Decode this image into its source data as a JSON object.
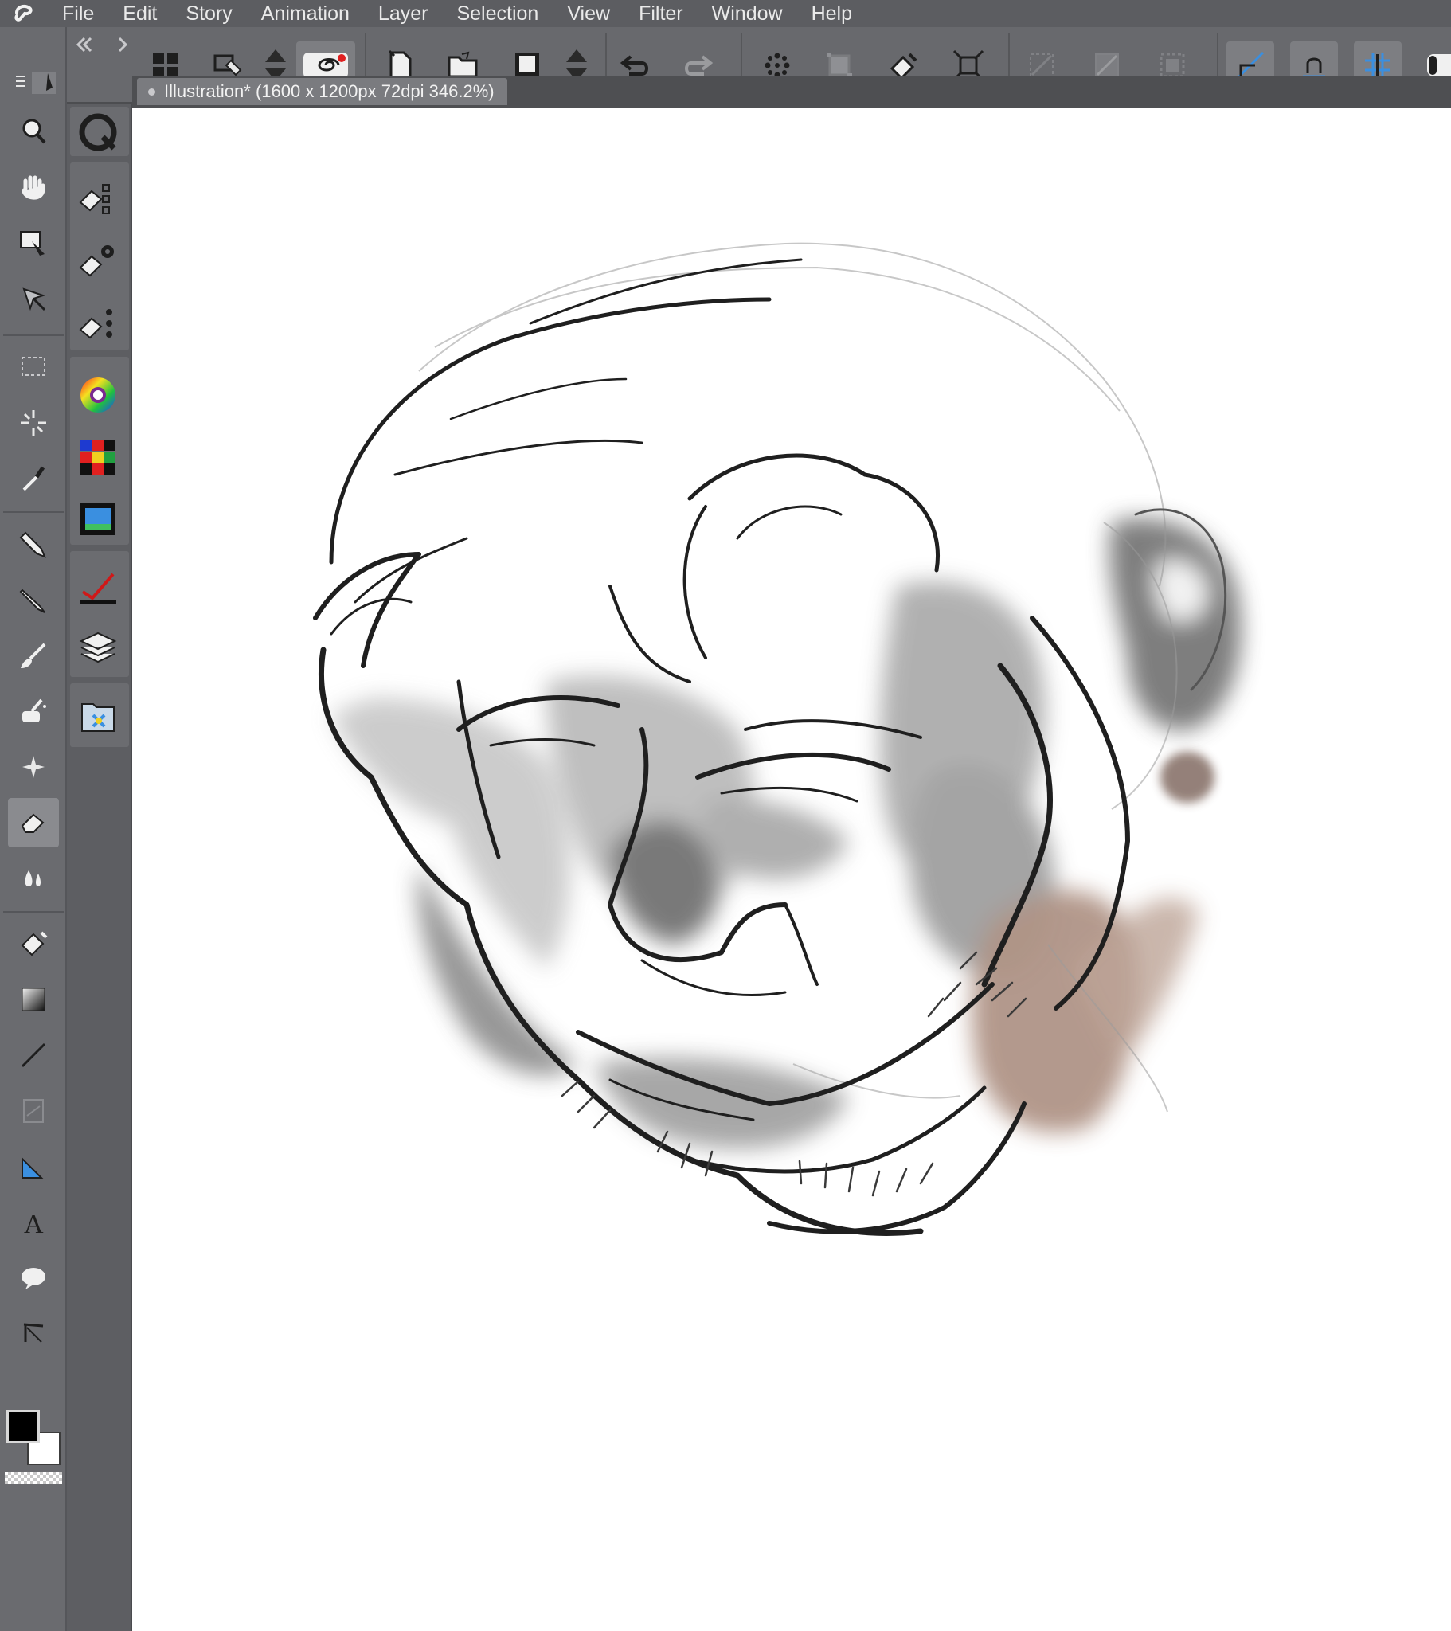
{
  "menu": {
    "items": [
      "File",
      "Edit",
      "Story",
      "Animation",
      "Layer",
      "Selection",
      "View",
      "Filter",
      "Window",
      "Help"
    ]
  },
  "command_bar": {
    "icons": [
      "sub-tool-grid-icon",
      "sub-view-icon",
      "up-down-arrows-icon",
      "spiral-icon",
      "new-file-icon",
      "open-folder-icon",
      "save-icon",
      "up-down-arrows-icon",
      "undo-icon",
      "redo-icon",
      "sparkle-icon",
      "transform-icon",
      "fill-icon",
      "expand-icon",
      "clear-outside-icon",
      "fill-selection-icon",
      "selection-border-icon",
      "snap-ruler-icon",
      "snap-special-ruler-icon",
      "snap-grid-icon"
    ]
  },
  "document": {
    "tab_title": "Illustration* (1600 x 1200px 72dpi 346.2%)"
  },
  "tools": {
    "items": [
      "zoom",
      "hand",
      "operation",
      "move-layer",
      "selection",
      "auto-select",
      "eyedropper",
      "pen",
      "pencil",
      "brush",
      "airbrush",
      "decoration",
      "eraser",
      "blend",
      "fill",
      "gradient",
      "figure",
      "frame",
      "ruler",
      "text",
      "balloon",
      "correct-line"
    ],
    "selected": "eraser"
  },
  "sub_panels": {
    "items": [
      "tool-property",
      "sub-tool",
      "sub-tool-detail",
      "color-wheel",
      "color-set",
      "animation-timeline",
      "layer-property",
      "layer",
      "material"
    ]
  },
  "colors": {
    "main": "#000000",
    "sub": "#ffffff",
    "accent_blue": "#3a8fe0",
    "ui_dark": "#5c5d61",
    "canvas_bg": "#ffffff",
    "skin_tone": "#a88c80"
  }
}
